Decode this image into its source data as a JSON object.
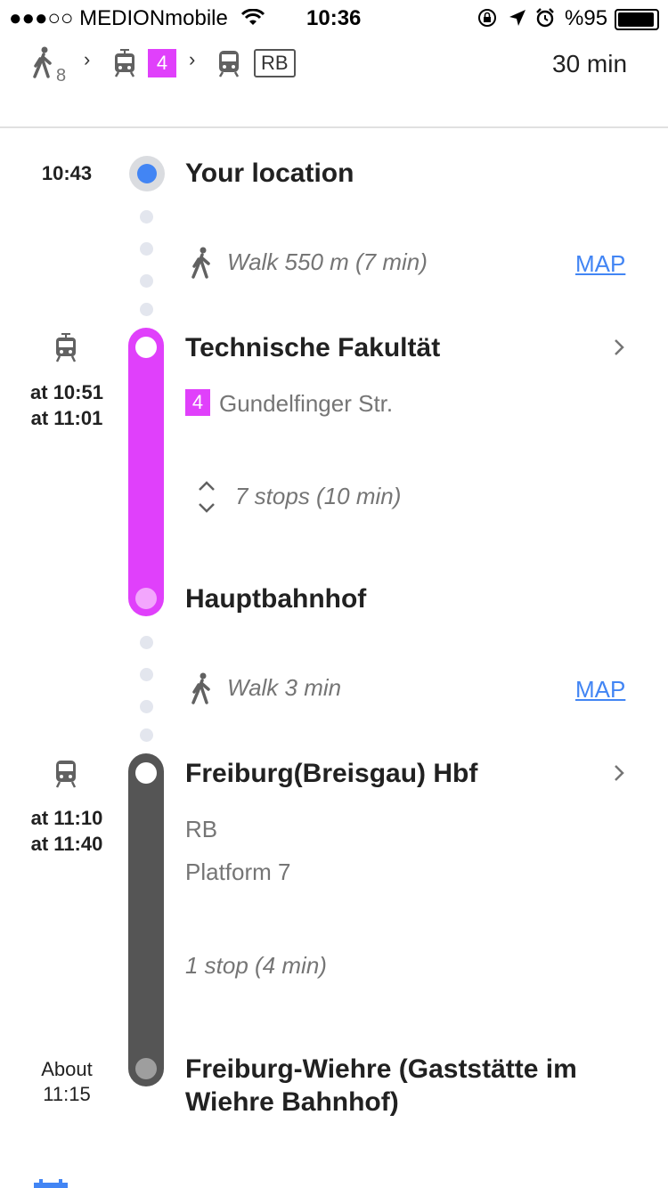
{
  "status_bar": {
    "carrier": "●●●○○ MEDIONmobile",
    "time": "10:36",
    "battery_percent": "%95"
  },
  "summary": {
    "walk_count": "8",
    "line_4": "4",
    "line_rb": "RB",
    "total_time": "30 min"
  },
  "steps": {
    "start_time": "10:43",
    "start_label": "Your location",
    "walk1_text": "Walk 550 m (7 min)",
    "walk1_map": "MAP",
    "tram_times": [
      "at 10:51",
      "at 11:01"
    ],
    "tram_from": "Technische Fakultät",
    "tram_line": "4",
    "tram_direction": "Gundelfinger Str.",
    "tram_stops": "7 stops (10 min)",
    "tram_to": "Hauptbahnhof",
    "walk2_text": "Walk 3 min",
    "walk2_map": "MAP",
    "train_times": [
      "at 11:10",
      "at 11:40"
    ],
    "train_from": "Freiburg(Breisgau) Hbf",
    "train_line": "RB",
    "train_platform": "Platform 7",
    "train_stops": "1 stop (4 min)",
    "arrival_time_label": "About",
    "arrival_time": "11:15",
    "train_to_line1": "Freiburg-Wiehre (Gaststätte im",
    "train_to_line2": "Wiehre Bahnhof)"
  },
  "colors": {
    "tram": "#e040fb",
    "train": "#555555",
    "accent": "#4285f4"
  }
}
